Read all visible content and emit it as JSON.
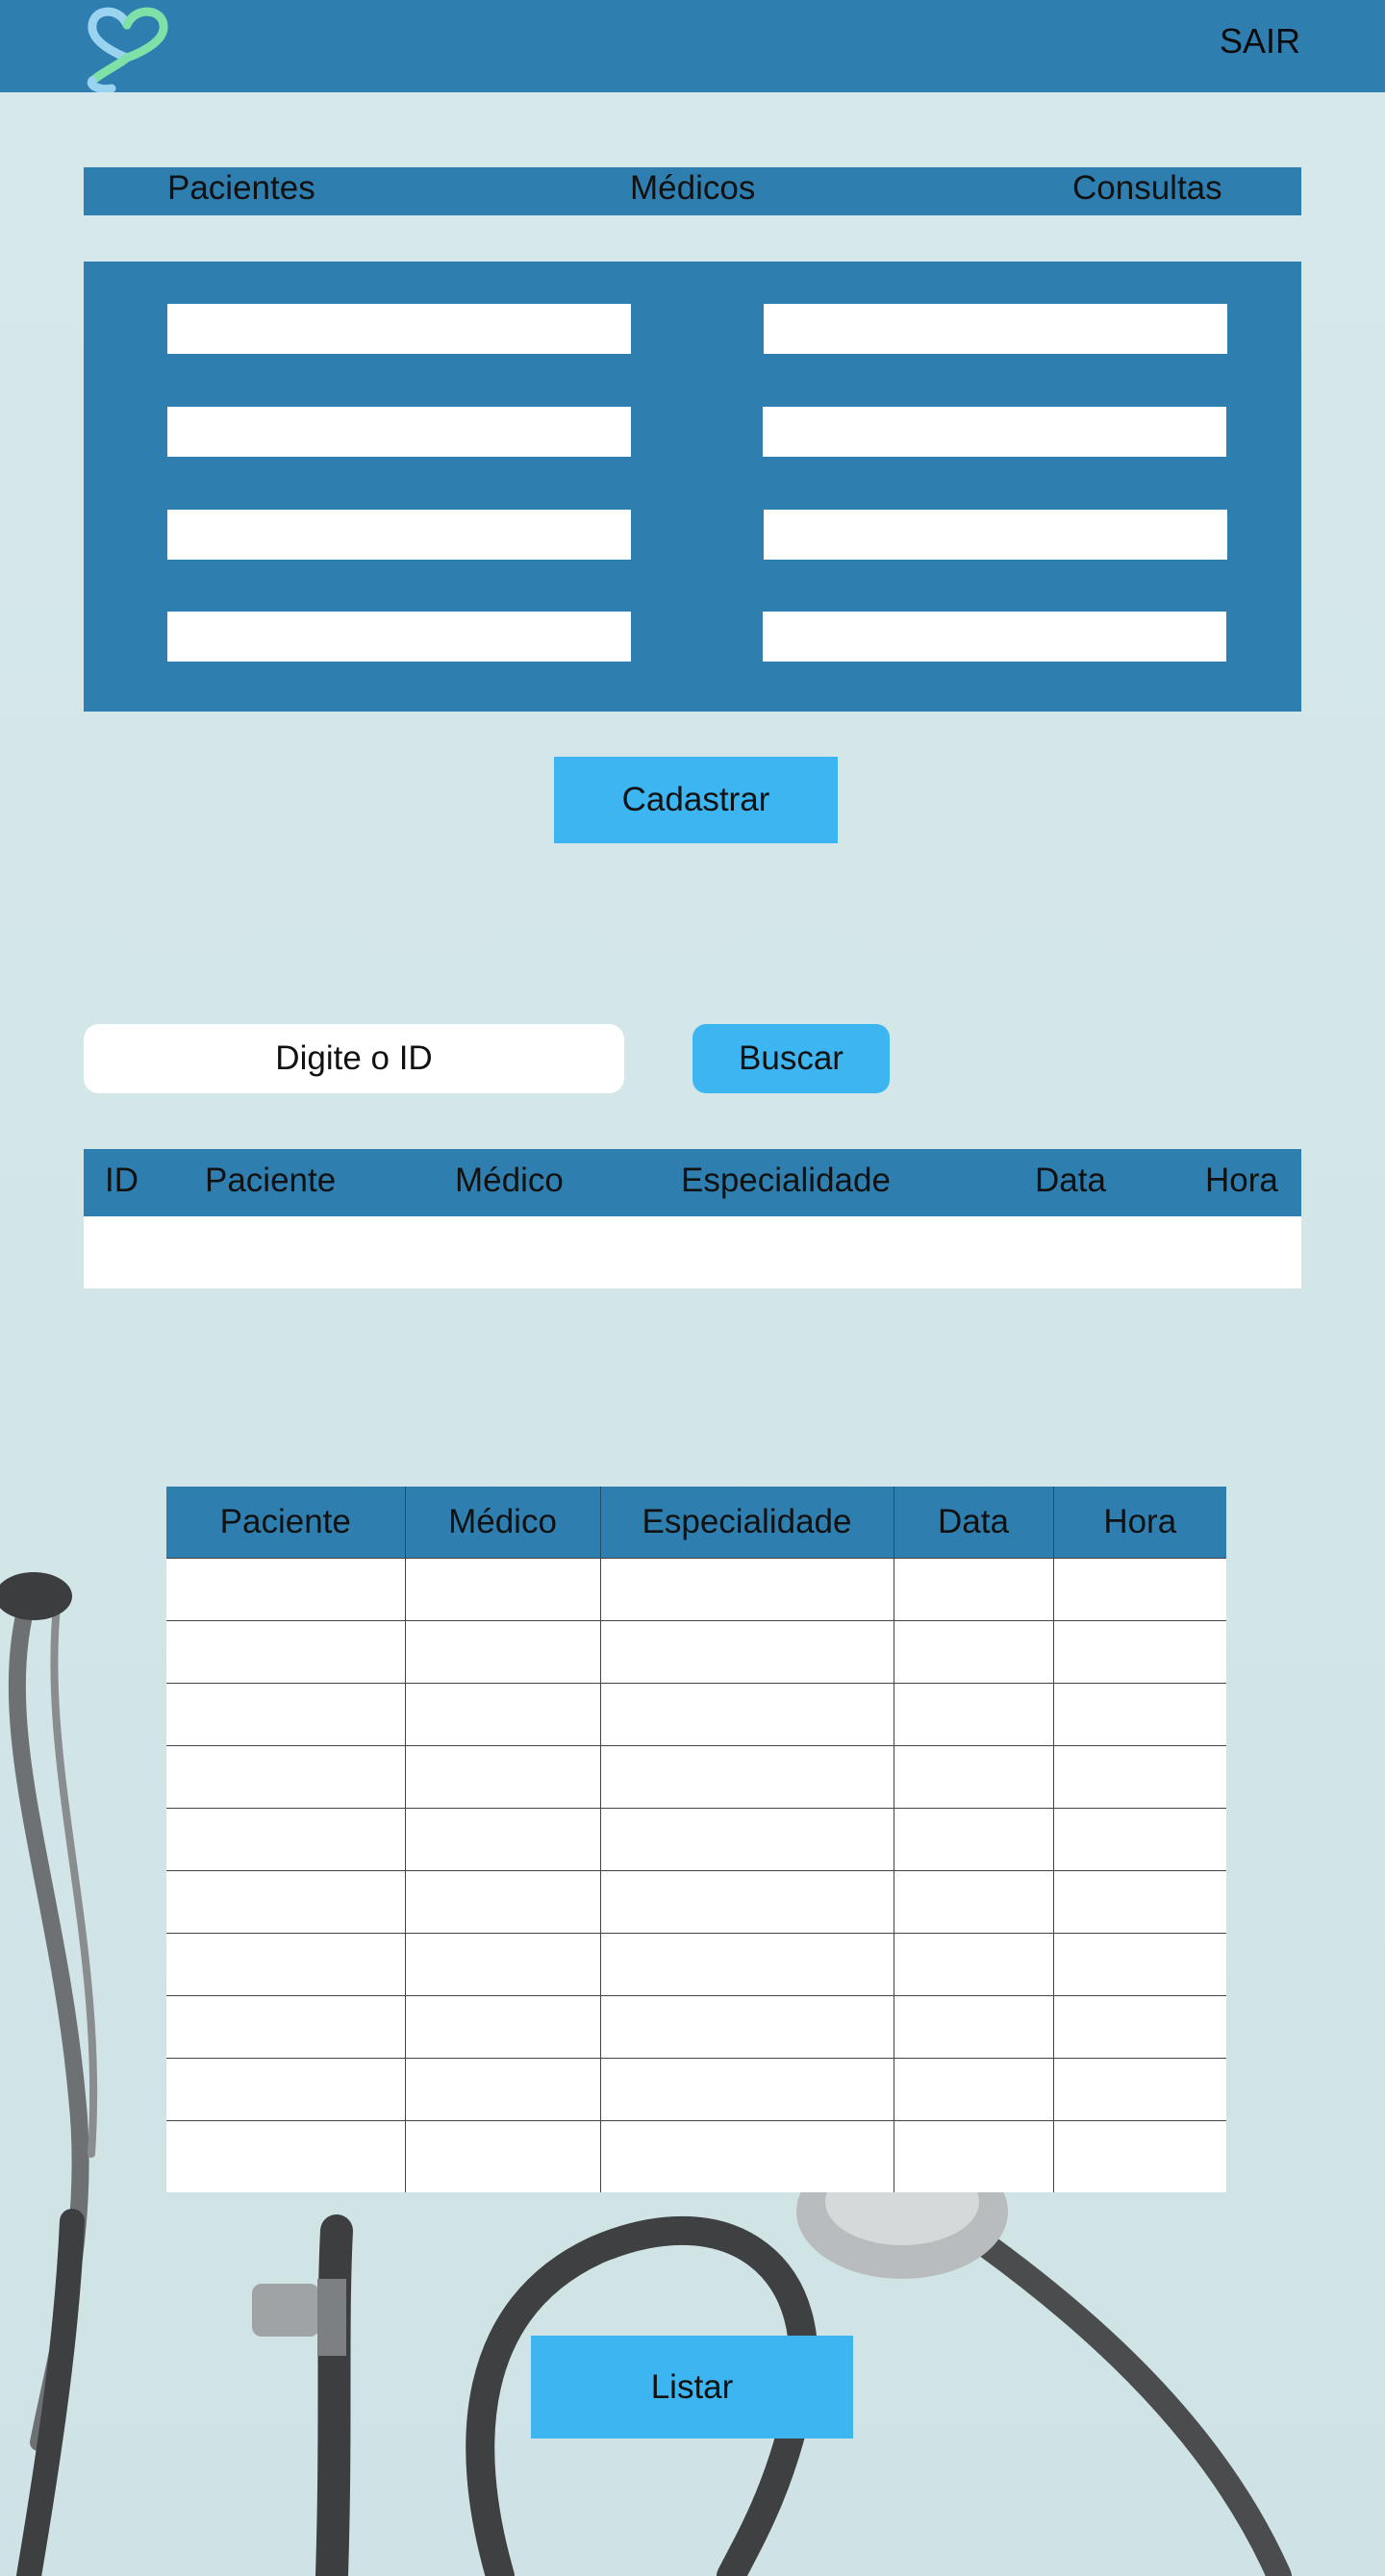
{
  "header": {
    "logout_label": "SAIR"
  },
  "nav": {
    "items": [
      {
        "label": "Pacientes"
      },
      {
        "label": "Médicos"
      },
      {
        "label": "Consultas"
      }
    ]
  },
  "form": {
    "submit_label": "Cadastrar"
  },
  "search": {
    "placeholder": "Digite o ID",
    "button_label": "Buscar"
  },
  "result_table": {
    "columns": [
      "ID",
      "Paciente",
      "Médico",
      "Especialidade",
      "Data",
      "Hora"
    ]
  },
  "list_table": {
    "columns": [
      "Paciente",
      "Médico",
      "Especialidade",
      "Data",
      "Hora"
    ]
  },
  "list": {
    "button_label": "Listar"
  },
  "colors": {
    "primary": "#2e7fb0",
    "accent": "#3db5f0",
    "background": "#d5e7e9"
  }
}
